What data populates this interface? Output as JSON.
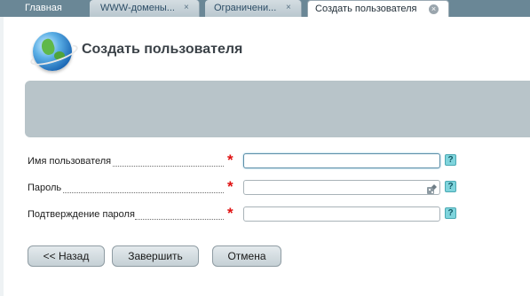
{
  "tabs": [
    {
      "label": "Главная",
      "closable": false
    },
    {
      "label": "WWW-домены...",
      "closable": true,
      "close_glyph": "×"
    },
    {
      "label": "Ограничени...",
      "closable": true,
      "close_glyph": "×"
    },
    {
      "label": "Создать пользователя",
      "closable": true,
      "close_glyph": "×",
      "active": true
    }
  ],
  "header": {
    "title": "Создать пользователя",
    "icon": "globe-icon"
  },
  "form": {
    "fields": [
      {
        "label": "Имя пользователя",
        "required_mark": "*",
        "value": "",
        "help_glyph": "?"
      },
      {
        "label": "Пароль",
        "required_mark": "*",
        "value": "",
        "help_glyph": "?"
      },
      {
        "label": "Подтверждение пароля",
        "required_mark": "*",
        "value": "",
        "help_glyph": "?"
      }
    ]
  },
  "buttons": {
    "back": "<< Назад",
    "finish": "Завершить",
    "cancel": "Отмена"
  },
  "colors": {
    "tabbar": "#6a8796",
    "panel": "#b8c4c9",
    "required": "#e01010",
    "help": "#7fd4dc"
  }
}
